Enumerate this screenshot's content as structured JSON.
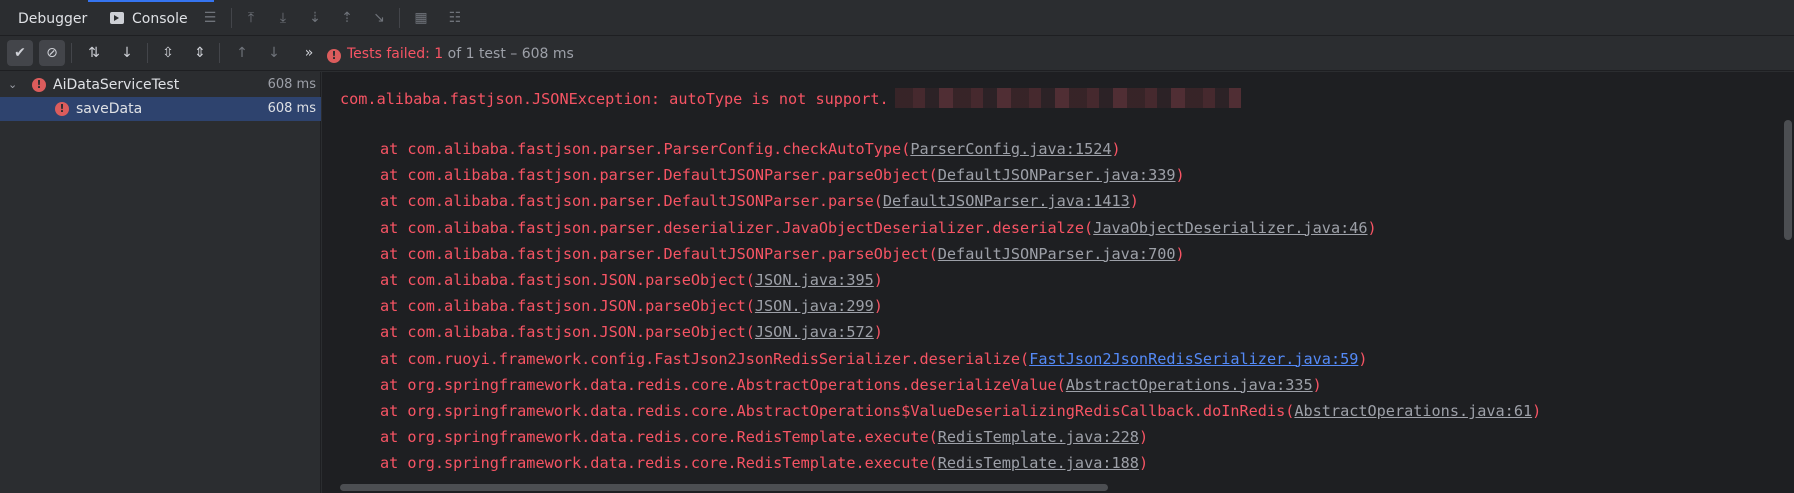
{
  "tabs": [
    {
      "label": "Debugger"
    },
    {
      "label": "Console"
    }
  ],
  "status": {
    "failed": "Tests failed: 1",
    "rest": " of 1 test – 608 ms"
  },
  "tree": [
    {
      "name": "AiDataServiceTest",
      "time": "608 ms",
      "expanded": true,
      "selected": false
    },
    {
      "name": "saveData",
      "time": "608 ms",
      "selected": true
    }
  ],
  "console": {
    "exception": "com.alibaba.fastjson.JSONException: autoType is not support.",
    "frames": [
      {
        "text": "at com.alibaba.fastjson.parser.ParserConfig.checkAutoType(",
        "link": "ParserConfig.java:1524"
      },
      {
        "text": "at com.alibaba.fastjson.parser.DefaultJSONParser.parseObject(",
        "link": "DefaultJSONParser.java:339"
      },
      {
        "text": "at com.alibaba.fastjson.parser.DefaultJSONParser.parse(",
        "link": "DefaultJSONParser.java:1413"
      },
      {
        "text": "at com.alibaba.fastjson.parser.deserializer.JavaObjectDeserializer.deserialze(",
        "link": "JavaObjectDeserializer.java:46"
      },
      {
        "text": "at com.alibaba.fastjson.parser.DefaultJSONParser.parseObject(",
        "link": "DefaultJSONParser.java:700"
      },
      {
        "text": "at com.alibaba.fastjson.JSON.parseObject(",
        "link": "JSON.java:395"
      },
      {
        "text": "at com.alibaba.fastjson.JSON.parseObject(",
        "link": "JSON.java:299"
      },
      {
        "text": "at com.alibaba.fastjson.JSON.parseObject(",
        "link": "JSON.java:572"
      },
      {
        "text": "at com.ruoyi.framework.config.FastJson2JsonRedisSerializer.deserialize(",
        "link": "FastJson2JsonRedisSerializer.java:59",
        "project_link": true
      },
      {
        "text": "at org.springframework.data.redis.core.AbstractOperations.deserializeValue(",
        "link": "AbstractOperations.java:335"
      },
      {
        "text": "at org.springframework.data.redis.core.AbstractOperations$ValueDeserializingRedisCallback.doInRedis(",
        "link": "AbstractOperations.java:61"
      },
      {
        "text": "at org.springframework.data.redis.core.RedisTemplate.execute(",
        "link": "RedisTemplate.java:228"
      },
      {
        "text": "at org.springframework.data.redis.core.RedisTemplate.execute(",
        "link": "RedisTemplate.java:188"
      }
    ]
  },
  "icons": {
    "toolbar_top": [
      "list-icon",
      "restore-layout-icon",
      "step-over-icon",
      "step-into-icon",
      "step-out-icon",
      "run-to-cursor-icon",
      "evaluate-icon",
      "settings-icon"
    ],
    "toolbar_test": [
      "show-passed-icon",
      "show-ignored-icon",
      "sort-alpha-icon",
      "sort-duration-icon",
      "expand-all-icon",
      "collapse-all-icon",
      "previous-failed-icon",
      "next-failed-icon",
      "more-icon"
    ]
  },
  "colors": {
    "error": "#f75464",
    "link": "#9da0a8",
    "project_link": "#548af7",
    "selection": "#2e436e"
  }
}
